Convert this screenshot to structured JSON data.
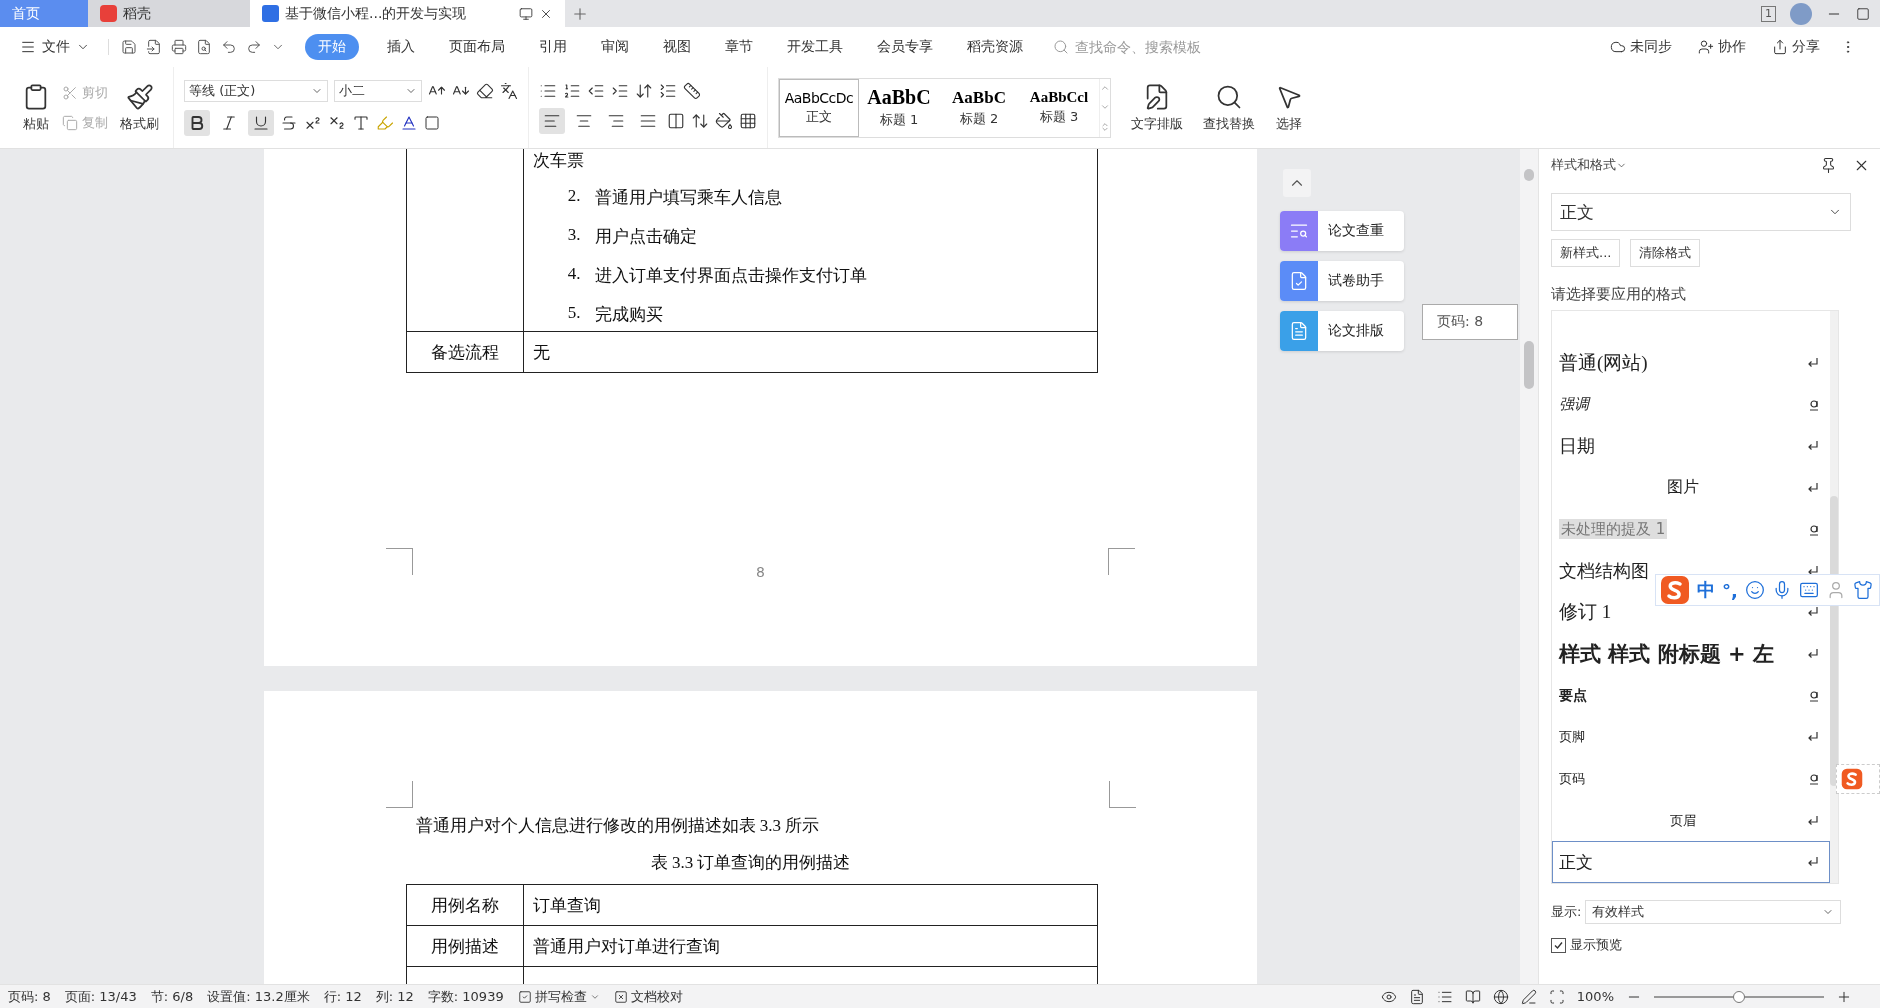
{
  "tabs": [
    {
      "label": "首页",
      "kind": "home",
      "selected": false
    },
    {
      "label": "稻壳",
      "kind": "app",
      "selected": false
    },
    {
      "label": "基于微信小程...的开发与实现",
      "kind": "document",
      "selected": true
    }
  ],
  "window_count": "1",
  "menu": {
    "file": "文件",
    "tabs": [
      {
        "label": "开始",
        "selected": true
      },
      {
        "label": "插入",
        "selected": false
      },
      {
        "label": "页面布局",
        "selected": false
      },
      {
        "label": "引用",
        "selected": false
      },
      {
        "label": "审阅",
        "selected": false
      },
      {
        "label": "视图",
        "selected": false
      },
      {
        "label": "章节",
        "selected": false
      },
      {
        "label": "开发工具",
        "selected": false
      },
      {
        "label": "会员专享",
        "selected": false
      },
      {
        "label": "稻壳资源",
        "selected": false
      }
    ],
    "search": {
      "placeholder": "查找命令、搜索模板"
    },
    "actions": [
      {
        "label": "未同步",
        "kind": "sync"
      },
      {
        "label": "协作",
        "kind": "collab"
      },
      {
        "label": "分享",
        "kind": "share"
      }
    ]
  },
  "ribbon": {
    "clipboard": [
      {
        "label": "粘贴",
        "kind": "paste",
        "disabled": false
      },
      {
        "label": "剪切",
        "kind": "cut",
        "disabled": true
      },
      {
        "label": "复制",
        "kind": "copy",
        "disabled": true
      },
      {
        "label": "格式刷",
        "kind": "painter",
        "disabled": false
      }
    ],
    "font": {
      "name": "等线 (正文)",
      "size": "小二"
    },
    "format": [
      {
        "kind": "bold",
        "active": true
      },
      {
        "kind": "italic",
        "active": false
      },
      {
        "kind": "underline",
        "active": true
      }
    ],
    "align": [
      {
        "kind": "left",
        "active": true
      },
      {
        "kind": "center",
        "active": false
      },
      {
        "kind": "right",
        "active": false
      },
      {
        "kind": "justify",
        "active": false
      }
    ],
    "styles": [
      {
        "preview": "AaBbCcDc",
        "label": "正文",
        "kind": "body",
        "selected": true
      },
      {
        "preview": "AaBbC",
        "label": "标题 1",
        "kind": "heading1",
        "selected": false
      },
      {
        "preview": "AaBbC",
        "label": "标题 2",
        "kind": "heading2",
        "selected": false
      },
      {
        "preview": "AaBbCcl",
        "label": "标题 3",
        "kind": "heading3",
        "selected": false
      }
    ],
    "tools": [
      {
        "label": "文字排版",
        "kind": "layout"
      },
      {
        "label": "查找替换",
        "kind": "find"
      },
      {
        "label": "选择",
        "kind": "select"
      }
    ]
  },
  "document": {
    "page_1": {
      "continued_text": "次车票",
      "steps": [
        {
          "number": "2.",
          "text": "普通用户填写乘车人信息"
        },
        {
          "number": "3.",
          "text": "用户点击确定"
        },
        {
          "number": "4.",
          "text": "进入订单支付界面点击操作支付订单"
        },
        {
          "number": "5.",
          "text": "完成购买"
        }
      ],
      "rows": [
        {
          "label": "备选流程",
          "value": "无"
        }
      ],
      "page_number": "8"
    },
    "page_2": {
      "paragraph": "普通用户对个人信息进行修改的用例描述如表 3.3 所示",
      "caption": "表 3.3 订单查询的用例描述",
      "rows": [
        {
          "label": "用例名称",
          "value": "订单查询"
        },
        {
          "label": "用例描述",
          "value": "普通用户对订单进行查询"
        }
      ]
    }
  },
  "side_tools": [
    {
      "label": "论文查重",
      "color": "#8b7cf6",
      "kind": "check"
    },
    {
      "label": "试卷助手",
      "color": "#5b8cf7",
      "kind": "exam"
    },
    {
      "label": "论文排版",
      "color": "#3aa0e8",
      "kind": "format"
    }
  ],
  "page_tooltip": "页码: 8",
  "styles_panel": {
    "title": "样式和格式",
    "current": "正文",
    "buttons": [
      "新样式...",
      "清除格式"
    ],
    "prompt": "请选择要应用的格式",
    "items": [
      {
        "label": "普通(网站)",
        "kind": "serif",
        "character_style": false,
        "selected": false
      },
      {
        "label": "强调",
        "kind": "emphasis",
        "character_style": true,
        "selected": false
      },
      {
        "label": "日期",
        "kind": "large",
        "character_style": false,
        "selected": false
      },
      {
        "label": "图片",
        "kind": "centered",
        "character_style": false,
        "selected": false
      },
      {
        "label": "未处理的提及 1",
        "kind": "highlight",
        "character_style": true,
        "selected": false
      },
      {
        "label": "文档结构图",
        "kind": "large",
        "character_style": false,
        "selected": false
      },
      {
        "label": "修订 1",
        "kind": "serif",
        "character_style": false,
        "selected": false
      },
      {
        "label": "样式 样式 附标题 + 左",
        "kind": "heading",
        "character_style": false,
        "selected": false
      },
      {
        "label": "要点",
        "kind": "strong",
        "character_style": true,
        "selected": false
      },
      {
        "label": "页脚",
        "kind": "small",
        "character_style": false,
        "selected": false
      },
      {
        "label": "页码",
        "kind": "small",
        "character_style": true,
        "selected": false
      },
      {
        "label": "页眉",
        "kind": "header",
        "character_style": false,
        "selected": false
      },
      {
        "label": "正文",
        "kind": "body",
        "character_style": false,
        "selected": true
      }
    ],
    "show_label": "显示:",
    "show_value": "有效样式",
    "preview": {
      "label": "显示预览",
      "checked": true
    }
  },
  "ime": {
    "mode": "中",
    "punctuation": "°,"
  },
  "status_bar": {
    "items": [
      "页码: 8",
      "页面: 13/43",
      "节: 6/8",
      "设置值: 13.2厘米",
      "行: 12",
      "列: 12",
      "字数: 10939"
    ],
    "checks": [
      {
        "label": "拼写检查",
        "kind": "spell"
      },
      {
        "label": "文档校对",
        "kind": "proof"
      }
    ],
    "zoom": {
      "label": "100%",
      "level": 0.5
    }
  }
}
